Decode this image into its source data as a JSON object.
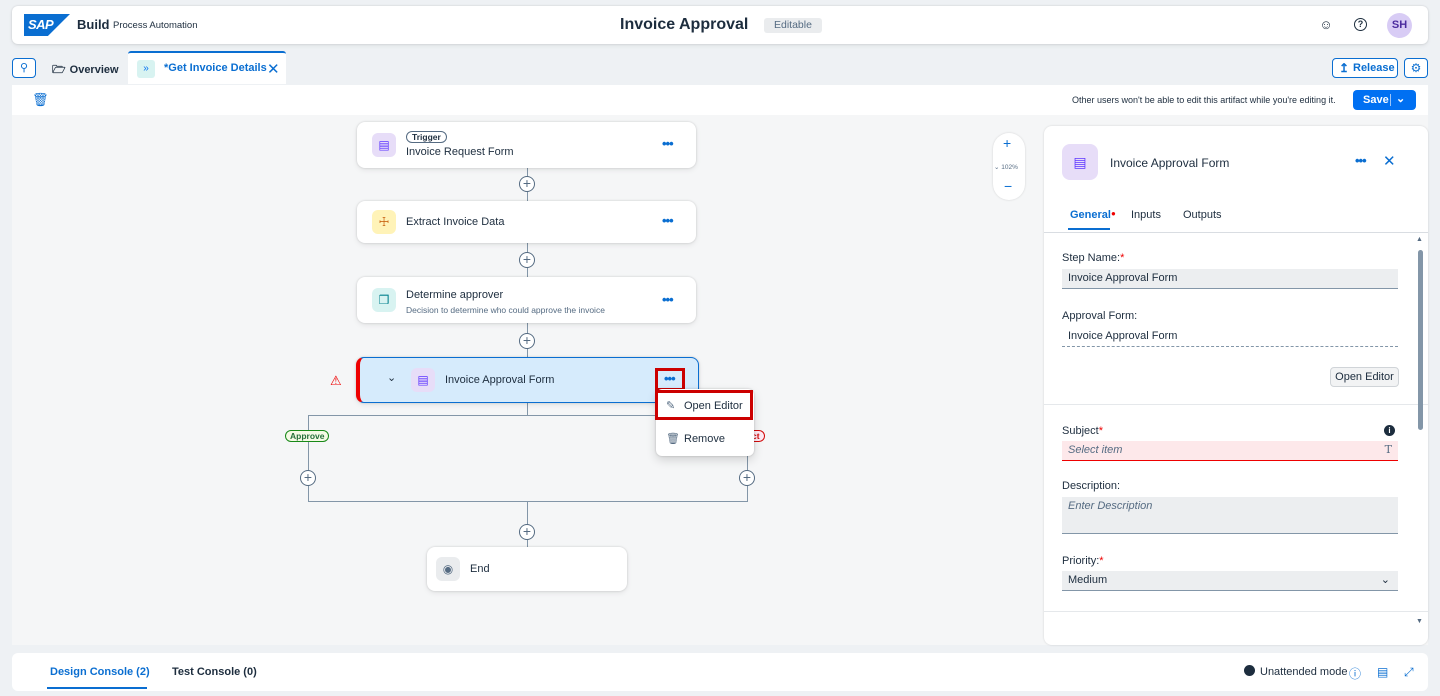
{
  "shell": {
    "logo_text": "SAP",
    "brand": "Build",
    "product": "Process Automation",
    "title": "Invoice Approval",
    "status_badge": "Editable",
    "avatar_initials": "SH",
    "icons": [
      "feedback-icon",
      "help-icon"
    ]
  },
  "tabs": {
    "overview_label": "Overview",
    "active_label": "*Get Invoice Details",
    "release_label": "Release"
  },
  "toolbar": {
    "lock_note": "Other users won't be able to edit this artifact while you're editing it.",
    "save_label": "Save"
  },
  "canvas": {
    "zoom_label": "102%",
    "nodes": {
      "trigger_badge": "Trigger",
      "trigger_name": "Invoice Request Form",
      "extract_name": "Extract Invoice Data",
      "decision_name": "Determine approver",
      "decision_sub": "Decision to determine who could approve the invoice",
      "approval_name": "Invoice Approval Form",
      "end_name": "End"
    },
    "conditions": {
      "approve": "Approve",
      "reject_partial": "ct"
    },
    "context_menu": {
      "open_editor": "Open Editor",
      "remove": "Remove"
    },
    "colors": {
      "accent": "#0a6ed1",
      "error": "#e00000",
      "approve_green": "#256f3a",
      "reject_red": "#d20a0a"
    }
  },
  "panel": {
    "title": "Invoice Approval Form",
    "tabs": [
      "General",
      "Inputs",
      "Outputs"
    ],
    "step_name_label": "Step Name:",
    "step_name_value": "Invoice Approval Form",
    "approval_form_label": "Approval Form:",
    "approval_form_value": "Invoice Approval Form",
    "open_editor_button": "Open Editor",
    "subject_label": "Subject",
    "subject_placeholder": "Select item",
    "description_label": "Description:",
    "description_placeholder": "Enter Description",
    "priority_label": "Priority:",
    "priority_value": "Medium"
  },
  "console": {
    "design_tab": "Design Console (2)",
    "test_tab": "Test Console (0)",
    "mode_label": "Unattended mode"
  }
}
